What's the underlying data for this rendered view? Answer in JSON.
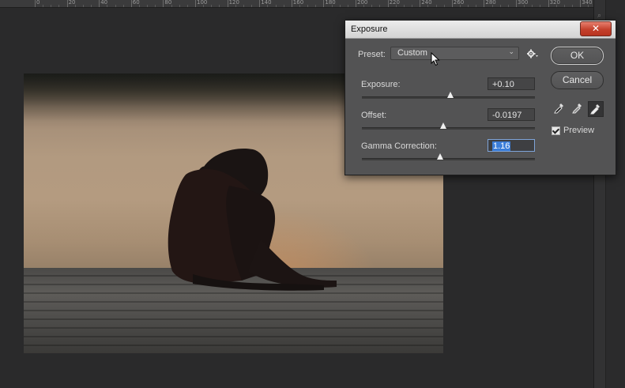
{
  "ruler": {
    "labels": [
      "0",
      "20",
      "40",
      "60",
      "80",
      "100",
      "120",
      "140",
      "160",
      "180",
      "200",
      "220",
      "240",
      "260",
      "280",
      "300",
      "320",
      "340"
    ]
  },
  "dialog": {
    "title": "Exposure",
    "close_label": "✕",
    "preset": {
      "label": "Preset:",
      "value": "Custom"
    },
    "settings_icon": "gear-icon",
    "exposure": {
      "label": "Exposure:",
      "value": "+0.10",
      "slider_fraction": 0.51
    },
    "offset": {
      "label": "Offset:",
      "value": "-0.0197",
      "slider_fraction": 0.47
    },
    "gamma": {
      "label": "Gamma Correction:",
      "value": "1.16",
      "slider_fraction": 0.45
    },
    "ok_label": "OK",
    "cancel_label": "Cancel",
    "eyedroppers": [
      "black-point-eyedropper-icon",
      "gray-point-eyedropper-icon",
      "white-point-eyedropper-icon"
    ],
    "preview": {
      "label": "Preview",
      "checked": true
    }
  },
  "colors": {
    "canvas_bg": "#2a2a2b",
    "dialog_bg": "#535354",
    "close_red": "#c4402c",
    "selection_blue": "#3b7dd8"
  }
}
